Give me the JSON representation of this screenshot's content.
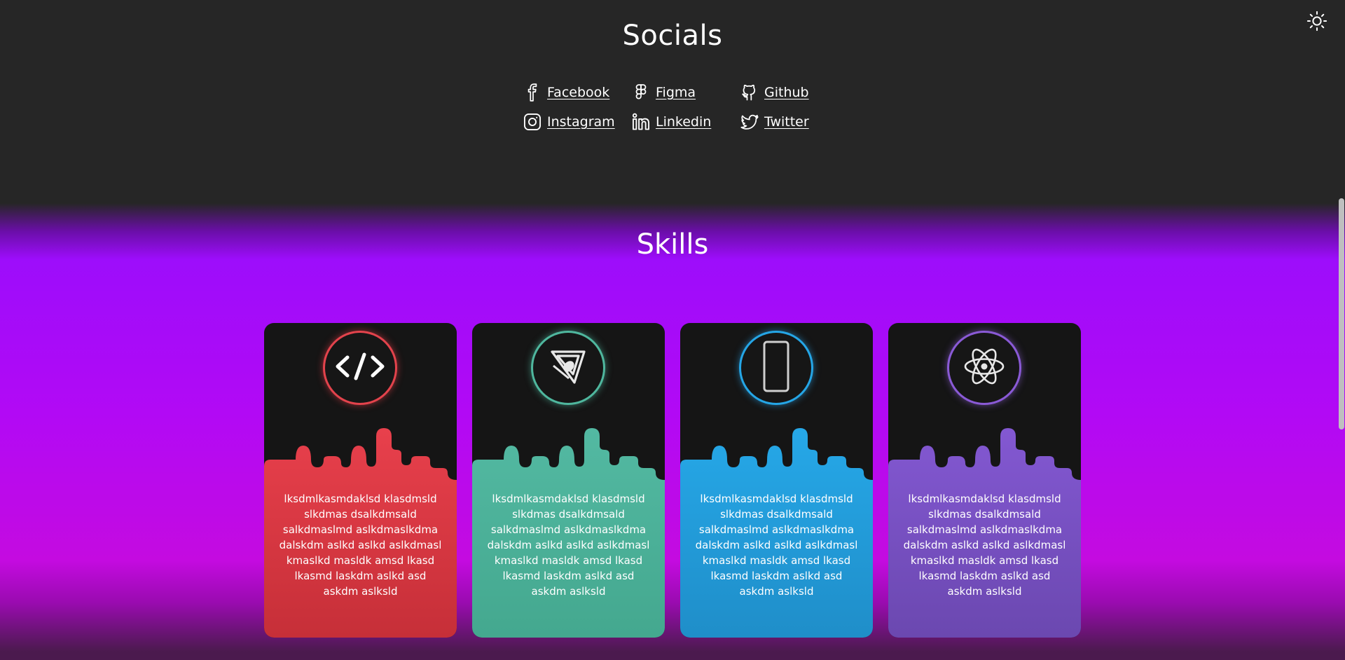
{
  "socials": {
    "title": "Socials",
    "links": [
      {
        "label": "Facebook",
        "icon": "facebook-icon"
      },
      {
        "label": "Figma",
        "icon": "figma-icon"
      },
      {
        "label": "Github",
        "icon": "github-icon"
      },
      {
        "label": "Instagram",
        "icon": "instagram-icon"
      },
      {
        "label": "Linkedin",
        "icon": "linkedin-icon"
      },
      {
        "label": "Twitter",
        "icon": "twitter-icon"
      }
    ]
  },
  "theme_toggle": {
    "icon": "sun-icon"
  },
  "skills": {
    "title": "Skills",
    "cards": [
      {
        "icon": "code-icon",
        "color_top": "#e8404c",
        "color_bottom": "#c62f38",
        "text": "lksdmlkasmdaklsd klasdmsld slkdmas dsalkdmsald salkdmaslmd aslkdmaslkdma dalskdm aslkd aslkd aslkdmasl kmaslkd masldk amsd lkasd lkasmd laskdm aslkd asd askdm aslksld"
      },
      {
        "icon": "design-pen-icon",
        "color_top": "#53b9a2",
        "color_bottom": "#44a88f",
        "text": "lksdmlkasmdaklsd klasdmsld slkdmas dsalkdmsald salkdmaslmd aslkdmaslkdma dalskdm aslkd aslkd aslkdmasl kmaslkd masldk amsd lkasd lkasmd laskdm aslkd asd askdm aslksld"
      },
      {
        "icon": "mobile-phone-icon",
        "color_top": "#26a8e8",
        "color_bottom": "#1f8ec9",
        "text": "lksdmlkasmdaklsd klasdmsld slkdmas dsalkdmsald salkdmaslmd aslkdmaslkdma dalskdm aslkd aslkd aslkdmasl kmaslkd masldk amsd lkasd lkasmd laskdm aslkd asd askdm aslksld"
      },
      {
        "icon": "react-atom-icon",
        "color_top": "#8358d2",
        "color_bottom": "#6b48b0",
        "text": "lksdmlkasmdaklsd klasdmsld slkdmas dsalkdmsald salkdmaslmd aslkdmaslkdma dalskdm aslkd aslkd aslkdmasl kmaslkd masldk amsd lkasd lkasmd laskdm aslkd asd askdm aslksld"
      }
    ]
  }
}
